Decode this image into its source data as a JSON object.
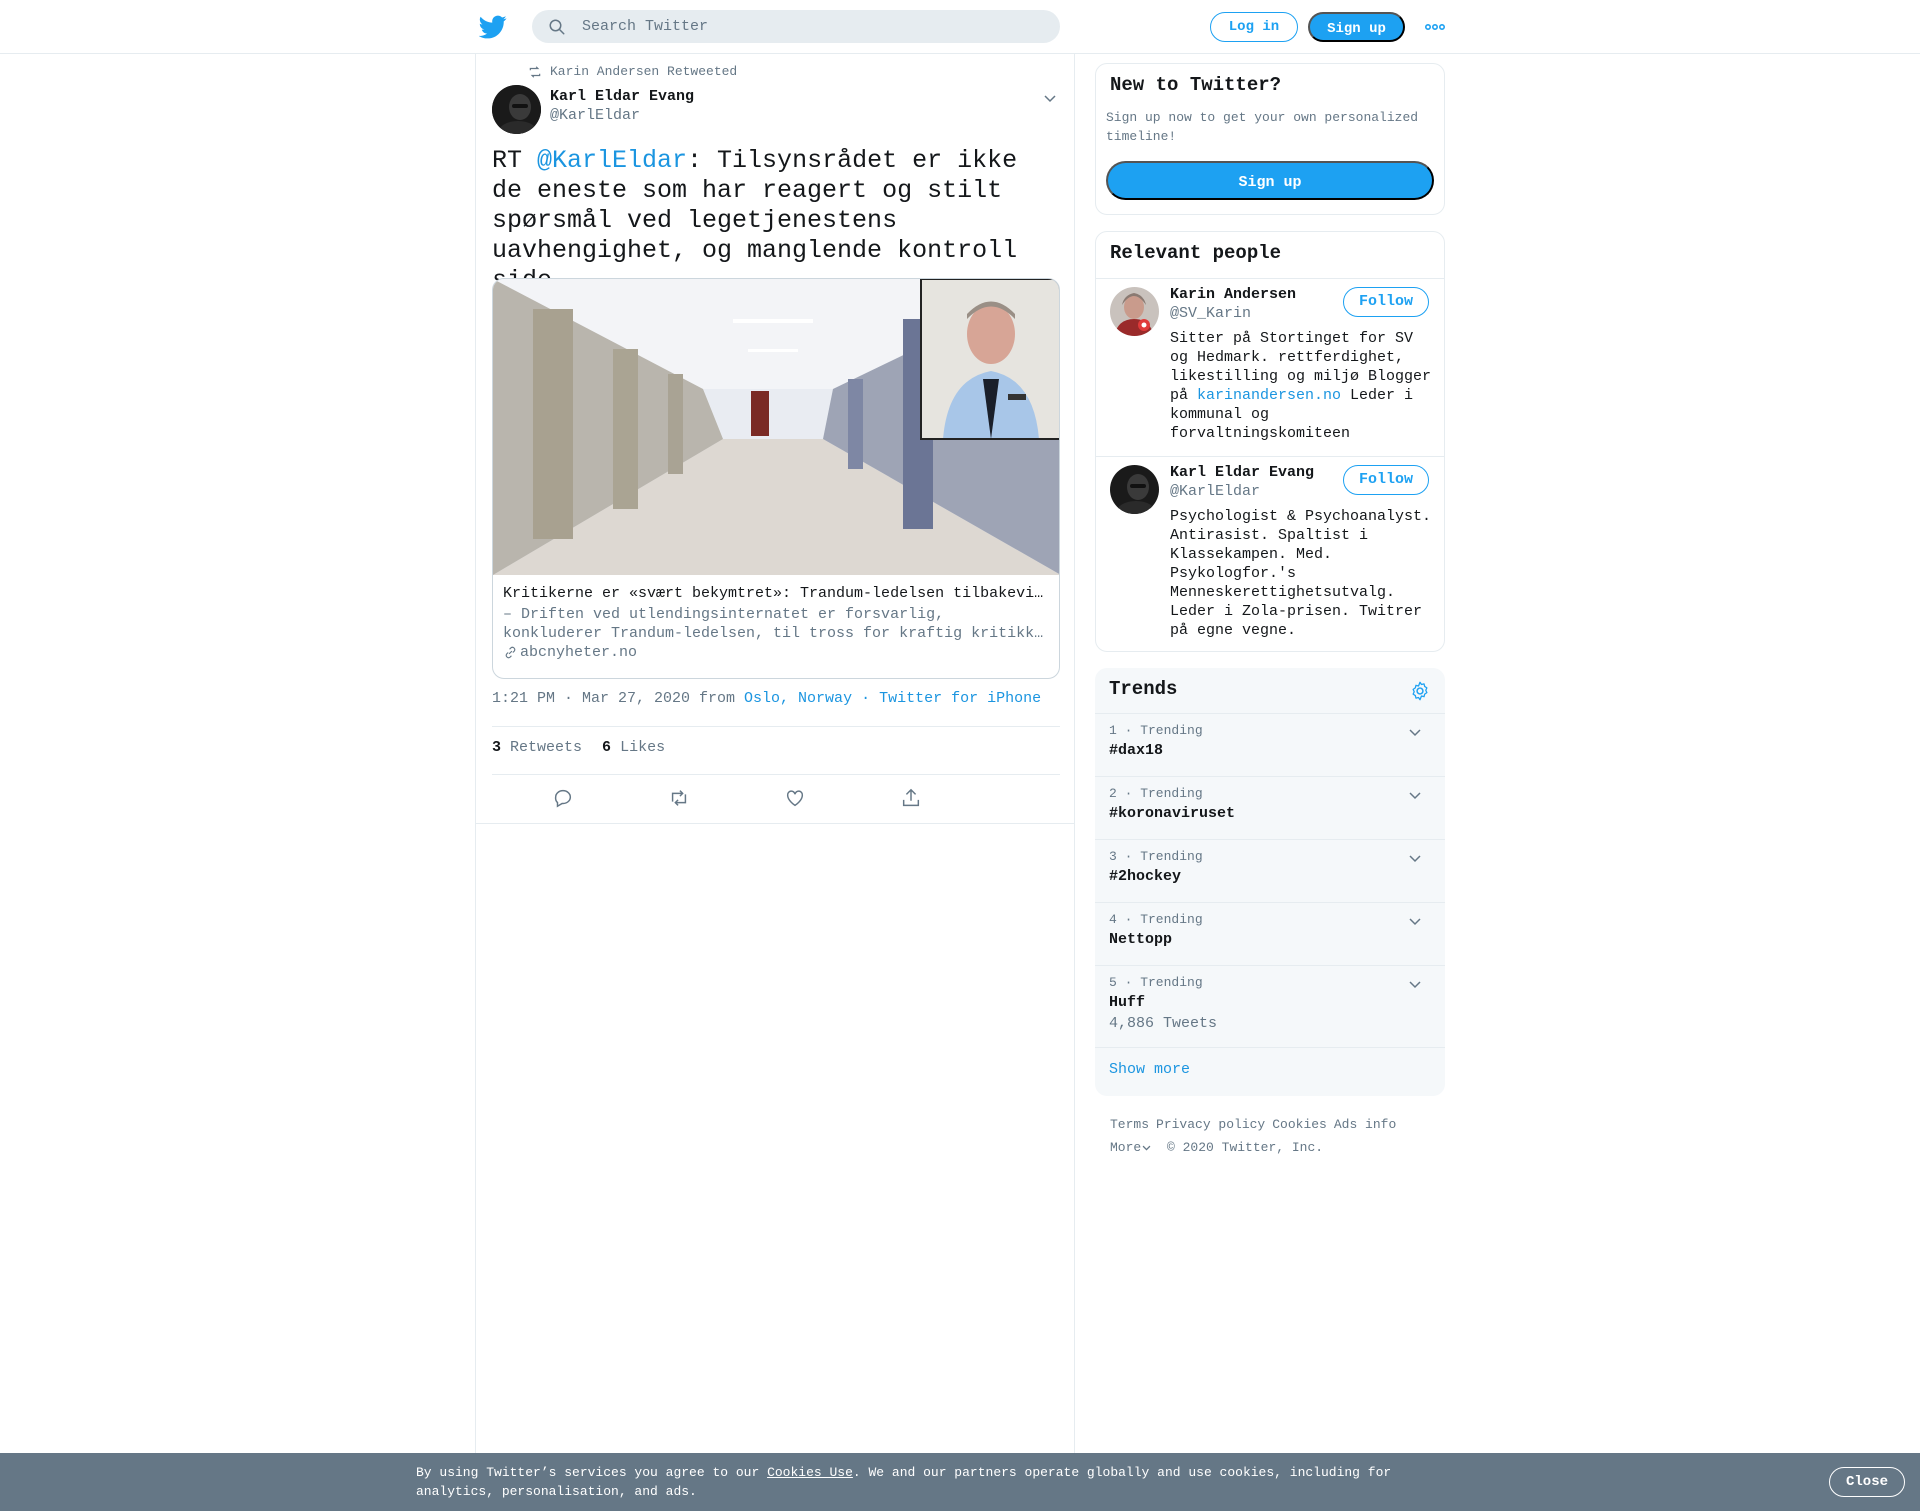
{
  "header": {
    "search_placeholder": "Search Twitter",
    "login_label": "Log in",
    "signup_label": "Sign up"
  },
  "tweet": {
    "retweeted_by": "Karin Andersen Retweeted",
    "author_name": "Karl Eldar Evang",
    "author_handle": "@KarlEldar",
    "text_prefix": "RT ",
    "text_mention": "@KarlEldar",
    "text_body": ": Tilsynsrådet er ikke de eneste som har reagert og stilt spørsmål ved legetjenestens uavhengighet, og manglende kontroll side…",
    "card": {
      "title": "Kritikerne er «svært bekymtret»: Trandum-ledelsen tilbakeviser all kritikk",
      "desc_line1": "– Driften ved utlendingsinternatet er forsvarlig,",
      "desc_line2": "konkluderer Trandum-ledelsen, til tross for kraftig kritikk fra flere hold",
      "domain": "abcnyheter.no"
    },
    "time": "1:21 PM · Mar 27, 2020 from ",
    "location": "Oslo, Norway",
    "dot": " · ",
    "source": "Twitter for iPhone",
    "retweets_count": "3",
    "retweets_label": "Retweets",
    "likes_count": "6",
    "likes_label": "Likes"
  },
  "sidebar": {
    "new_to_twitter": {
      "title": "New to Twitter?",
      "text": "Sign up now to get your own personalized timeline!",
      "button": "Sign up"
    },
    "relevant_people": {
      "title": "Relevant people",
      "people": [
        {
          "name": "Karin Andersen",
          "handle": "@SV_Karin",
          "follow": "Follow",
          "bio_before": "Sitter på Stortinget for SV og Hedmark. rettferdighet, likestilling og miljø Blogger på ",
          "bio_link": "karinandersen.no",
          "bio_after": " Leder i kommunal og forvaltningskomiteen"
        },
        {
          "name": "Karl Eldar Evang",
          "handle": "@KarlEldar",
          "follow": "Follow",
          "bio": "Psychologist & Psychoanalyst. Antirasist. Spaltist i Klassekampen. Med. Psykologfor.'s Menneskerettighetsutvalg. Leder i Zola-prisen. Twitrer på egne vegne."
        }
      ]
    },
    "trends": {
      "title": "Trends",
      "items": [
        {
          "meta": "1 · Trending",
          "name": "#dax18",
          "count": ""
        },
        {
          "meta": "2 · Trending",
          "name": "#koronaviruset",
          "count": ""
        },
        {
          "meta": "3 · Trending",
          "name": "#2hockey",
          "count": ""
        },
        {
          "meta": "4 · Trending",
          "name": "Nettopp",
          "count": ""
        },
        {
          "meta": "5 · Trending",
          "name": "Huff",
          "count": "4,886 Tweets"
        }
      ],
      "show_more": "Show more"
    },
    "footer": {
      "terms": "Terms",
      "privacy": "Privacy policy",
      "cookies": "Cookies",
      "ads": "Ads info",
      "more": "More",
      "copyright": "© 2020 Twitter, Inc."
    }
  },
  "cookie_banner": {
    "text_before": "By using Twitter’s services you agree to our ",
    "link": "Cookies Use",
    "text_after": ". We and our partners operate globally and use cookies, including for analytics, personalisation, and ads.",
    "close": "Close"
  },
  "colors": {
    "brand": "#1da1f2",
    "link": "#1b95e0",
    "secondary_text": "#657786",
    "banner": "#657786"
  }
}
